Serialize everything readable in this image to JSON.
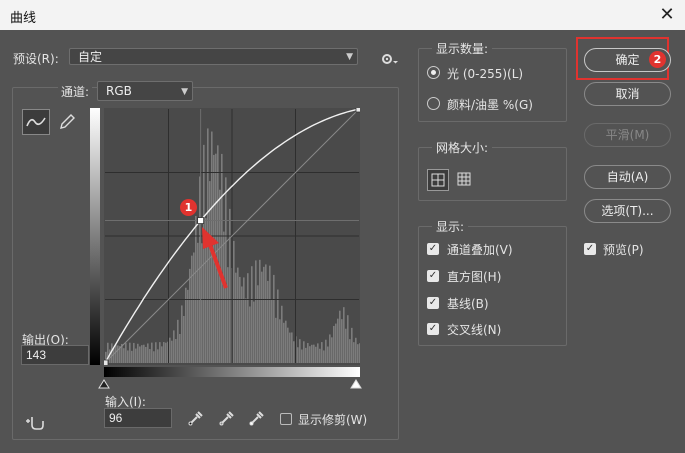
{
  "window": {
    "title": "曲线",
    "close_glyph": "✕"
  },
  "preset": {
    "label": "预设(R):",
    "value": "自定"
  },
  "channel": {
    "label": "通道:",
    "value": "RGB"
  },
  "output": {
    "label": "输出(O):",
    "value": "143"
  },
  "input": {
    "label": "输入(I):",
    "value": "96"
  },
  "show_clipping": {
    "label": "显示修剪(W)",
    "checked": false
  },
  "show_amount": {
    "title": "显示数量:",
    "options": [
      {
        "label": "光 (0-255)(L)",
        "selected": true
      },
      {
        "label": "颜料/油墨 %(G)",
        "selected": false
      }
    ]
  },
  "grid_size": {
    "title": "网格大小:"
  },
  "display": {
    "title": "显示:",
    "items": [
      {
        "label": "通道叠加(V)",
        "checked": true
      },
      {
        "label": "直方图(H)",
        "checked": true
      },
      {
        "label": "基线(B)",
        "checked": true
      },
      {
        "label": "交叉线(N)",
        "checked": true
      }
    ]
  },
  "buttons": {
    "ok": "确定",
    "cancel": "取消",
    "smooth": "平滑(M)",
    "auto": "自动(A)",
    "options": "选项(T)..."
  },
  "preview": {
    "label": "预览(P)",
    "checked": true
  },
  "annotations": {
    "badge1": "1",
    "badge2": "2"
  },
  "curve": {
    "point_input": 96,
    "point_output": 143,
    "range": [
      0,
      255
    ]
  },
  "colors": {
    "highlight": "#e0332f",
    "plot_bg": "#4a4a4a"
  }
}
